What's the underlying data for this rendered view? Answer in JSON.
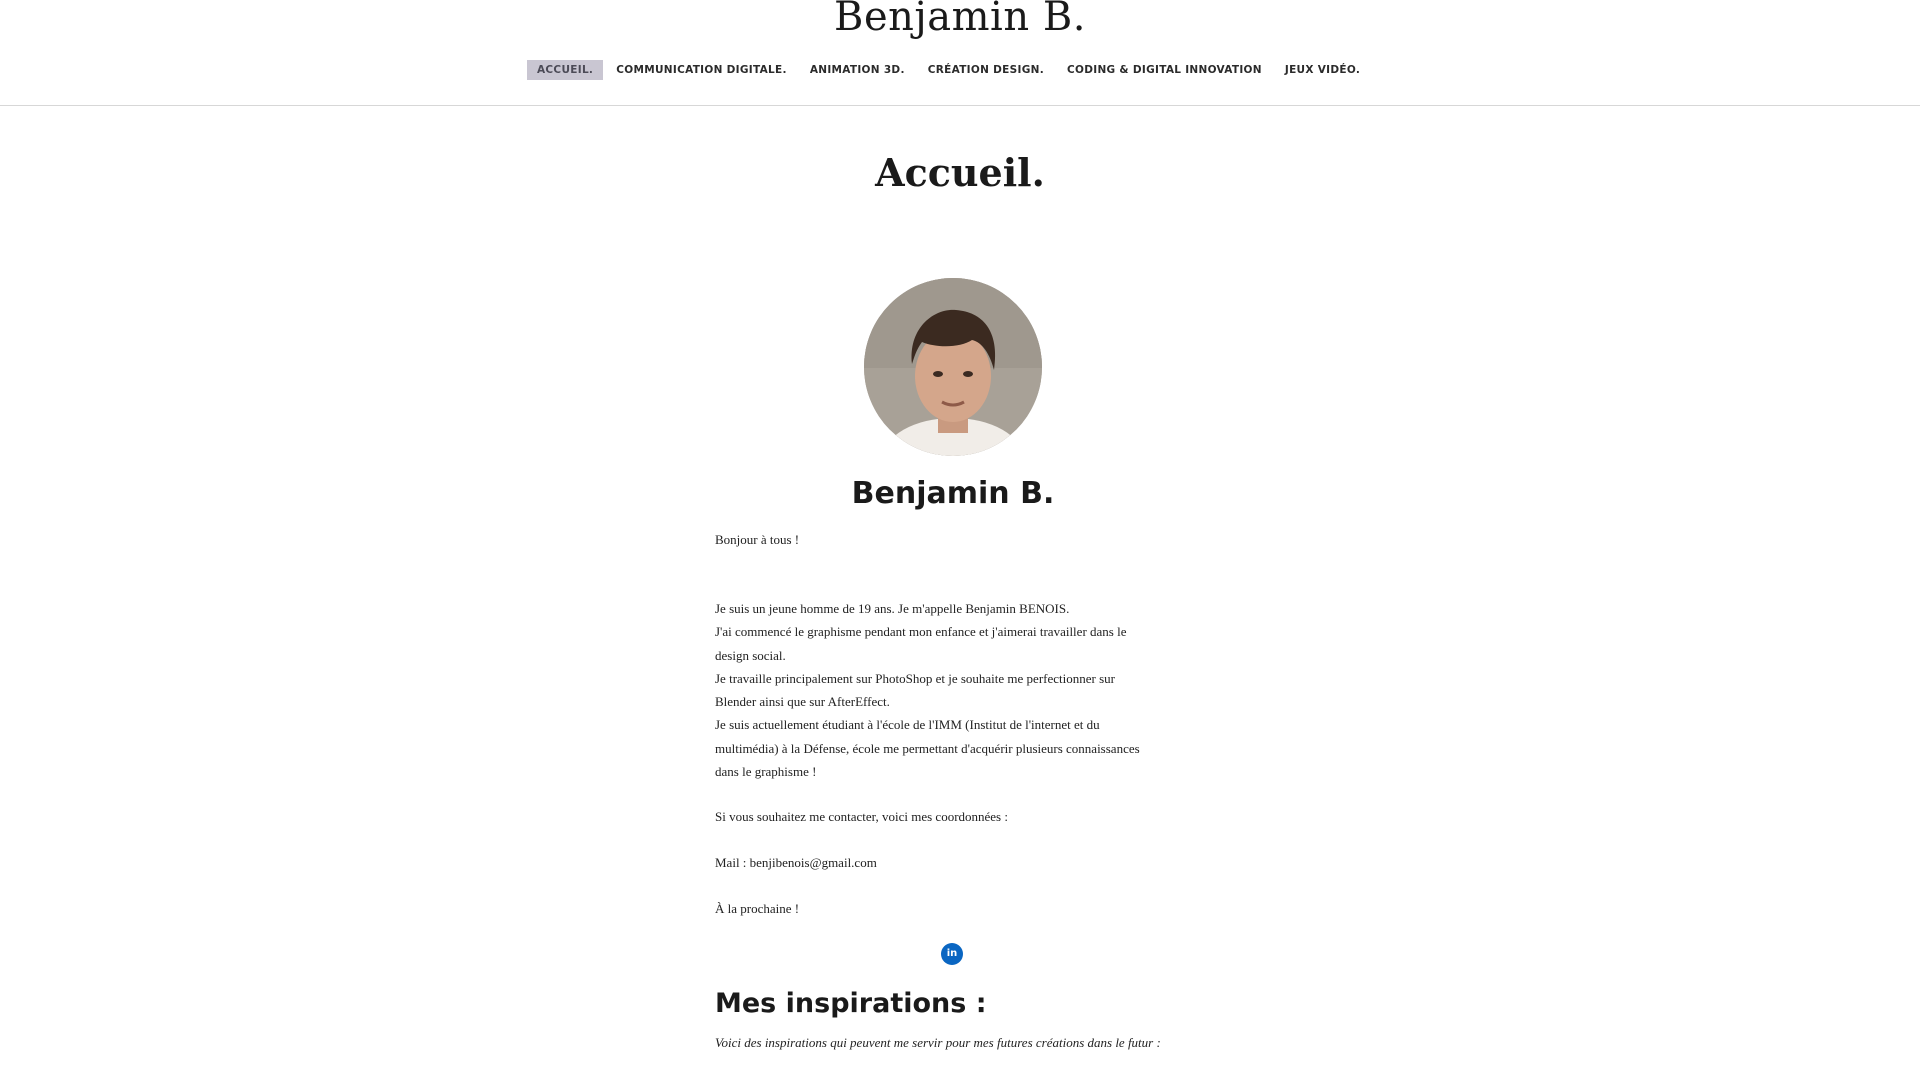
{
  "site": {
    "title": "Benjamin B."
  },
  "nav": {
    "items": [
      {
        "label": "ACCUEIL.",
        "active": true
      },
      {
        "label": "COMMUNICATION DIGITALE.",
        "active": false
      },
      {
        "label": "ANIMATION 3D.",
        "active": false
      },
      {
        "label": "CRÉATION DESIGN.",
        "active": false
      },
      {
        "label": "CODING & DIGITAL INNOVATION",
        "active": false
      },
      {
        "label": "JEUX VIDÉO.",
        "active": false
      }
    ]
  },
  "page": {
    "heading": "Accueil."
  },
  "profile": {
    "name": "Benjamin B.",
    "avatar_icon": "profile-photo"
  },
  "bio": {
    "greeting": "Bonjour à tous !",
    "lines": [
      "Je suis un jeune homme de 19 ans. Je m'appelle Benjamin BENOIS.",
      "J'ai commencé le graphisme pendant mon enfance et j'aimerai travailler dans le",
      "design social.",
      "Je travaille principalement sur PhotoShop et je souhaite me perfectionner sur",
      "Blender ainsi que sur AfterEffect.",
      "Je suis actuellement étudiant à l'école de l'IMM (Institut de l'internet et du",
      "multimédia) à la Défense, école me permettant d'acquérir plusieurs connaissances",
      "dans le graphisme !"
    ],
    "contact_intro": "Si vous souhaitez me contacter, voici mes coordonnées :",
    "mail": "Mail : benjibenois@gmail.com",
    "sign_off": "À la prochaine !"
  },
  "social": {
    "linkedin_icon": "linkedin-icon",
    "linkedin_glyph": "in",
    "linkedin_color": "#0a66c2"
  },
  "inspirations": {
    "heading": "Mes inspirations :",
    "subtitle": "Voici des inspirations qui peuvent me servir pour mes futures créations dans le futur :"
  },
  "colors": {
    "nav_active_bg": "#c9c6d2",
    "text": "#1a1a1a"
  }
}
